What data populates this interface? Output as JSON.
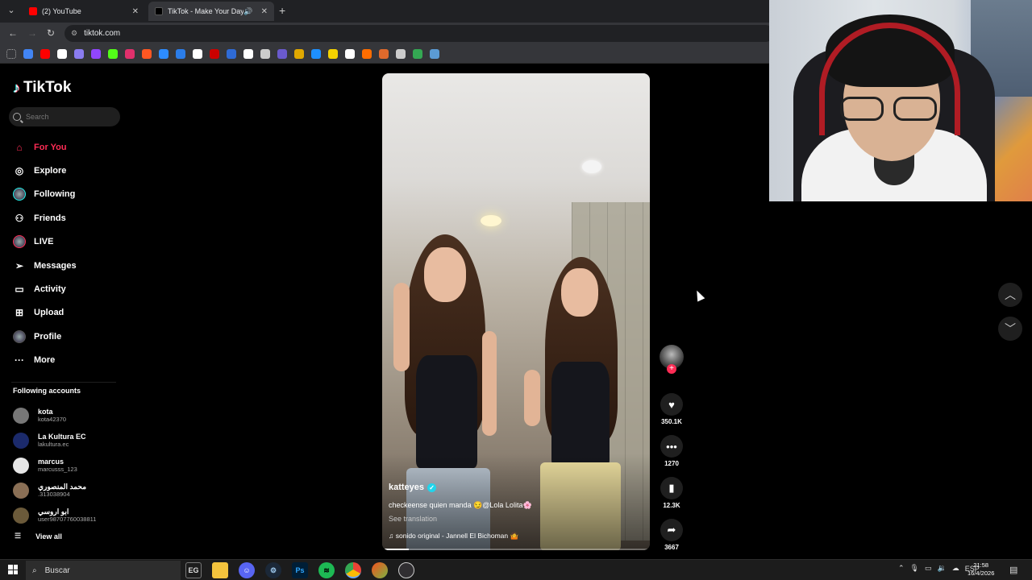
{
  "browser": {
    "tabs": [
      {
        "label": "(2) YouTube",
        "favicon_color": "#ff0000"
      },
      {
        "label": "TikTok - Make Your Day",
        "favicon_color": "#000000"
      }
    ],
    "url": "tiktok.com",
    "bookmark_colors": [
      "#4285f4",
      "#ff0000",
      "#ffffff",
      "#8a7cf0",
      "#9146ff",
      "#53fc18",
      "#e1306c",
      "#ff5722",
      "#2d8cff",
      "#2b7de9",
      "#ffffff",
      "#cc0000",
      "#2f6bd6",
      "#ffffff",
      "#cccccc",
      "#6a5acd",
      "#e0a800",
      "#1e90ff",
      "#f5d300",
      "#ffffff",
      "#ff6d00",
      "#e06a2c",
      "#cccccc",
      "#34a853",
      "#5b9bd5"
    ]
  },
  "sidebar": {
    "logo": "TikTok",
    "search_placeholder": "Search",
    "nav": [
      {
        "label": "For You",
        "icon": "home-icon",
        "active": true
      },
      {
        "label": "Explore",
        "icon": "compass-icon",
        "active": false
      },
      {
        "label": "Following",
        "icon": "following-avatar-icon",
        "active": false
      },
      {
        "label": "Friends",
        "icon": "friends-icon",
        "active": false
      },
      {
        "label": "LIVE",
        "icon": "live-avatar-icon",
        "active": false
      },
      {
        "label": "Messages",
        "icon": "messages-icon",
        "active": false
      },
      {
        "label": "Activity",
        "icon": "activity-icon",
        "active": false
      },
      {
        "label": "Upload",
        "icon": "upload-icon",
        "active": false
      },
      {
        "label": "Profile",
        "icon": "profile-avatar-icon",
        "active": false
      },
      {
        "label": "More",
        "icon": "more-icon",
        "active": false
      }
    ],
    "following_title": "Following accounts",
    "accounts": [
      {
        "name": "kota",
        "handle": "kota42370"
      },
      {
        "name": "La Kultura EC",
        "handle": "lakultura.ec"
      },
      {
        "name": "marcus",
        "handle": "marcusss_123"
      },
      {
        "name": "محمد المنصوري",
        "handle": ".313038904"
      },
      {
        "name": "ابو اروسي",
        "handle": "user9870776003881​1"
      }
    ],
    "view_all": "View all"
  },
  "video": {
    "author": "katteyes",
    "caption": "checkeense quien manda 😏@Lola Lolita🌸",
    "see_translation": "See translation",
    "music": "♫  sonido original - Jannell El Bichoman 🤷",
    "progress": 0.1
  },
  "actions": {
    "likes": "350.1K",
    "comments": "1270",
    "saves": "12.3K",
    "shares": "3667"
  },
  "taskbar": {
    "search_placeholder": "Buscar",
    "lang": "ESP",
    "time": "21:58",
    "date": "16/4/2026"
  }
}
